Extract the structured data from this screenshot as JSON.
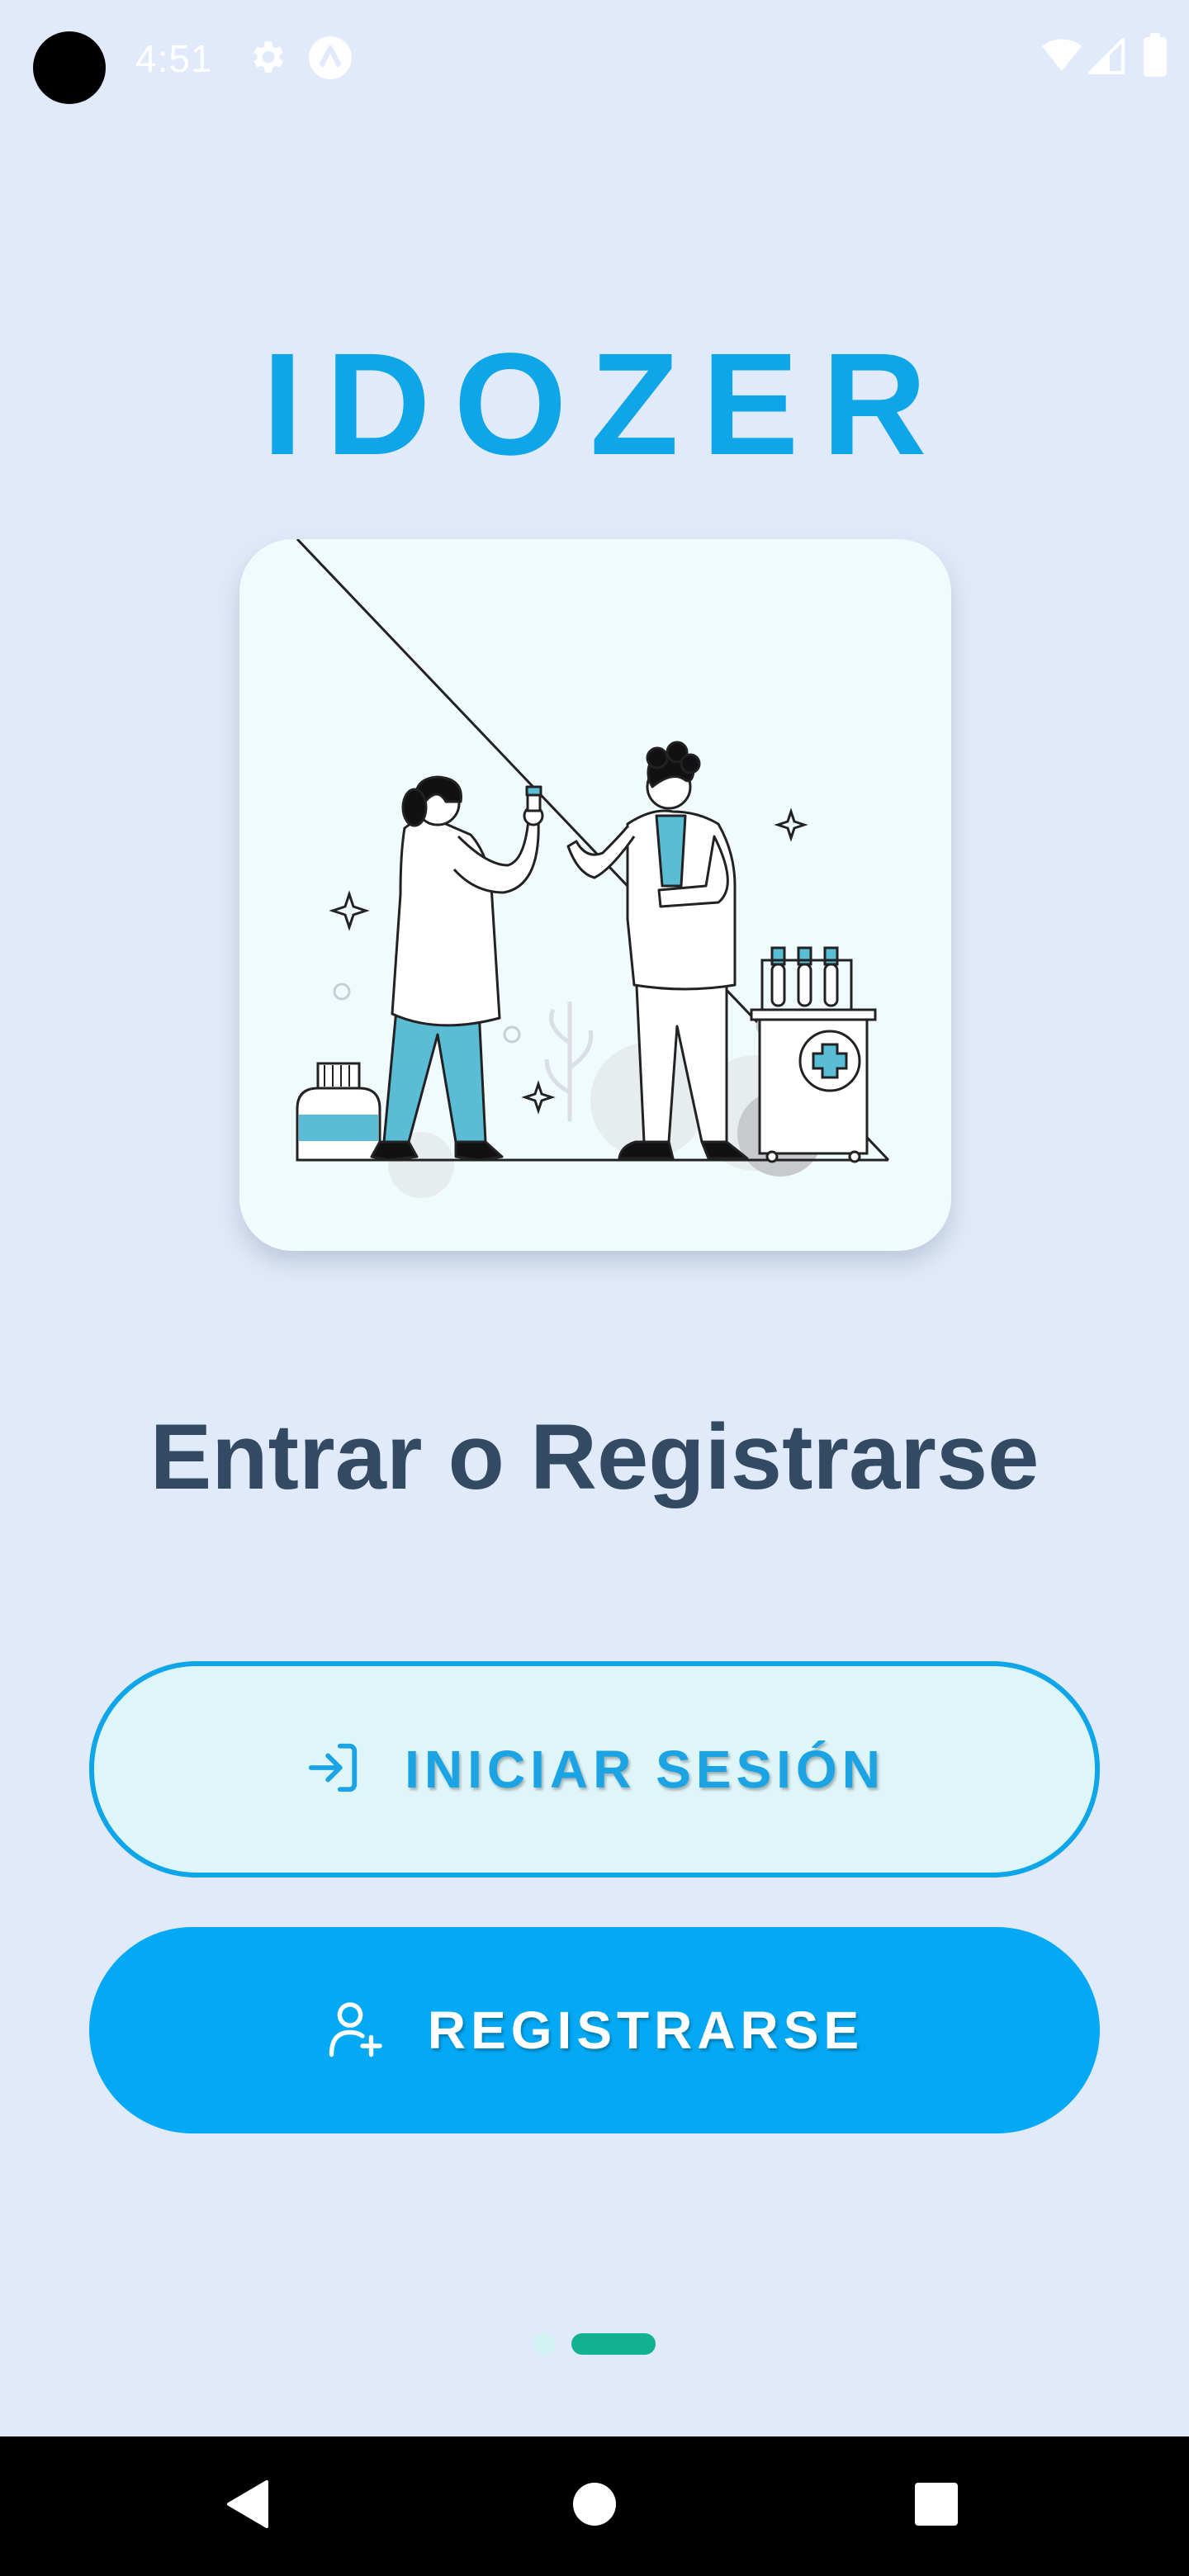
{
  "status_bar": {
    "time": "4:51",
    "icons": [
      "settings-gear-icon",
      "a-badge-icon",
      "wifi-icon",
      "cell-signal-icon",
      "battery-icon"
    ]
  },
  "app": {
    "title": "IDOZER"
  },
  "hero": {
    "illustration": "doctors-with-lab-sample-illustration"
  },
  "page": {
    "heading": "Entrar o Registrarse"
  },
  "buttons": {
    "login_label": "INICIAR SESIÓN",
    "login_icon": "login-arrow-icon",
    "register_label": "REGISTRARSE",
    "register_icon": "add-user-icon"
  },
  "pager": {
    "total_pages": 2,
    "active_page": 2
  },
  "navigation": {
    "icons": [
      "back-triangle-icon",
      "home-circle-icon",
      "recents-square-icon"
    ]
  },
  "colors": {
    "background": "#e1eafa",
    "accent": "#0ea5e9",
    "register_button": "#03a9f4",
    "heading": "#334a63",
    "pager_active": "#13b091"
  }
}
